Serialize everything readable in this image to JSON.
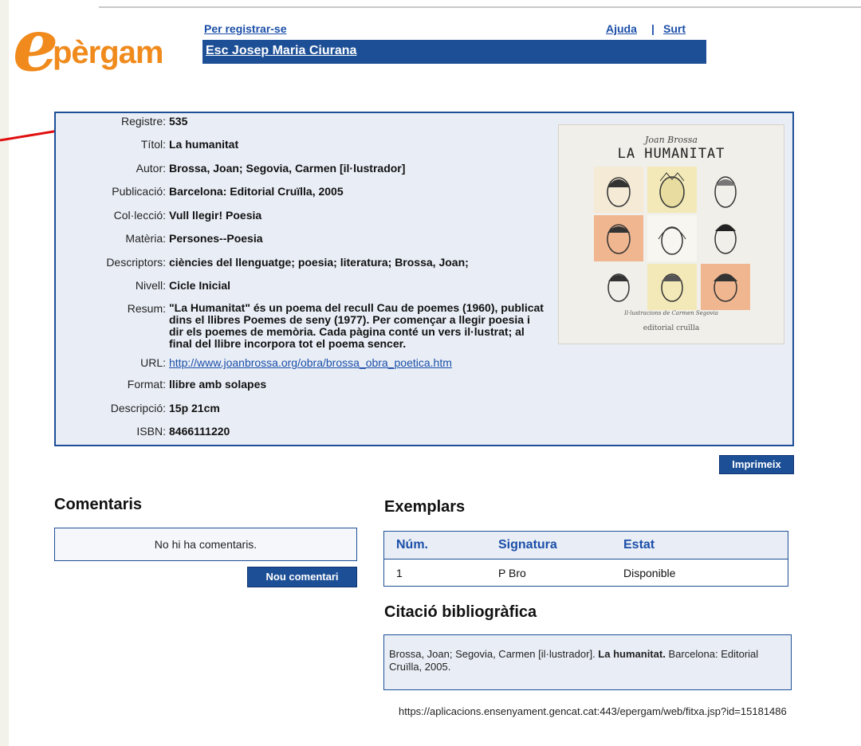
{
  "header": {
    "logo_first": "e",
    "logo_rest": "pèrgam",
    "register_link": "Per registrar-se",
    "help_link": "Ajuda",
    "separator": "|",
    "exit_link": "Surt",
    "school": "Esc Josep Maria Ciurana"
  },
  "record": {
    "fields": [
      {
        "label": "Registre:",
        "value": "535"
      },
      {
        "label": "Títol:",
        "value": "La humanitat"
      },
      {
        "label": "Autor:",
        "value": "Brossa, Joan; Segovia, Carmen [il·lustrador]"
      },
      {
        "label": "Publicació:",
        "value": "Barcelona: Editorial Cruïlla, 2005"
      },
      {
        "label": "Col·lecció:",
        "value": "Vull llegir! Poesia"
      },
      {
        "label": "Matèria:",
        "value": "Persones--Poesia"
      },
      {
        "label": "Descriptors:",
        "value": "ciències del llenguatge; poesia; literatura; Brossa, Joan;"
      },
      {
        "label": "Nivell:",
        "value": "Cicle Inicial"
      }
    ],
    "summary_label": "Resum:",
    "summary": "\"La Humanitat\" és un poema del recull Cau de poemes (1960), publicat dins el llibres Poemes de seny (1977). Per començar a llegir poesia i dir els poemes de memòria. Cada pàgina conté un vers il·lustrat; al final del llibre incorpora tot el poema sencer.",
    "url_label": "URL:",
    "url": "http://www.joanbrossa.org/obra/brossa_obra_poetica.htm",
    "fields2": [
      {
        "label": "Format:",
        "value": "llibre amb solapes"
      },
      {
        "label": "Descripció:",
        "value": "15p 21cm"
      },
      {
        "label": "ISBN:",
        "value": "8466111220"
      }
    ],
    "cover": {
      "author": "Joan Brossa",
      "title": "LA HUMANITAT",
      "illustrator": "Il·lustracions de Carmen Segovia",
      "publisher": "editorial cruïlla"
    }
  },
  "print_button": "Imprimeix",
  "comments": {
    "heading": "Comentaris",
    "empty": "No hi ha comentaris.",
    "new_button": "Nou comentari"
  },
  "copies": {
    "heading": "Exemplars",
    "columns": [
      "Núm.",
      "Signatura",
      "Estat"
    ],
    "rows": [
      [
        "1",
        "P Bro",
        "Disponible"
      ]
    ]
  },
  "citation": {
    "heading": "Citació bibliogràfica",
    "authors": "Brossa, Joan; Segovia, Carmen [il·lustrador].",
    "title": "La humanitat.",
    "rest": "Barcelona: Editorial Cruïlla, 2005.",
    "url": "https://aplicacions.ensenyament.gencat.cat:443/epergam/web/fitxa.jsp?id=15181486"
  },
  "colors": {
    "brand_orange": "#f08a1c",
    "brand_blue": "#1d4f96",
    "panel_bg": "#e9eef6"
  }
}
